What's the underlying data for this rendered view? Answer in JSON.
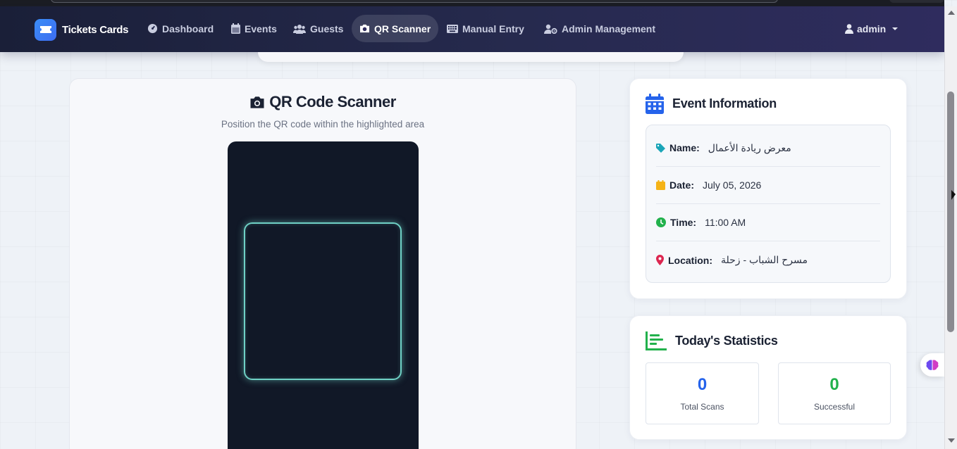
{
  "app": {
    "brand": "Tickets Cards",
    "user": "admin"
  },
  "nav": {
    "dashboard": "Dashboard",
    "events": "Events",
    "guests": "Guests",
    "qr_scanner": "QR Scanner",
    "manual_entry": "Manual Entry",
    "admin_management": "Admin Management",
    "active": "QR Scanner"
  },
  "scanner": {
    "title": "QR Code Scanner",
    "subtitle": "Position the QR code within the highlighted area"
  },
  "event_info": {
    "heading": "Event Information",
    "name_label": "Name:",
    "name_value": "معرض ريادة الأعمال",
    "date_label": "Date:",
    "date_value": "July 05, 2026",
    "time_label": "Time:",
    "time_value": "11:00 AM",
    "location_label": "Location:",
    "location_value": "مسرح الشباب - زحلة"
  },
  "stats": {
    "heading": "Today's Statistics",
    "total_scans_value": "0",
    "total_scans_label": "Total Scans",
    "successful_value": "0",
    "successful_label": "Successful"
  },
  "colors": {
    "nav_bg": "#1a1f38",
    "accent_blue": "#2563eb",
    "success_green": "#22b14c",
    "scan_frame": "#6fd1c5"
  }
}
